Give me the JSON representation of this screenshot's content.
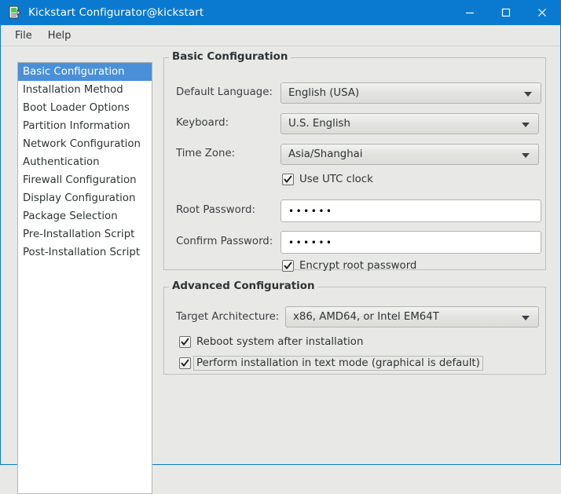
{
  "window": {
    "title": "Kickstart Configurator@kickstart",
    "app_icon": "kickstart-app-icon",
    "accent_color": "#0a7ad0",
    "selection_color": "#4a90d9",
    "controls": {
      "minimize": "minimize-icon",
      "maximize": "maximize-icon",
      "close": "close-icon"
    }
  },
  "menubar": {
    "items": [
      {
        "label": "File"
      },
      {
        "label": "Help"
      }
    ]
  },
  "sidebar": {
    "selected_index": 0,
    "items": [
      {
        "label": "Basic Configuration"
      },
      {
        "label": "Installation Method"
      },
      {
        "label": "Boot Loader Options"
      },
      {
        "label": "Partition Information"
      },
      {
        "label": "Network Configuration"
      },
      {
        "label": "Authentication"
      },
      {
        "label": "Firewall Configuration"
      },
      {
        "label": "Display Configuration"
      },
      {
        "label": "Package Selection"
      },
      {
        "label": "Pre-Installation Script"
      },
      {
        "label": "Post-Installation Script"
      }
    ]
  },
  "basic": {
    "title": "Basic Configuration",
    "language": {
      "label": "Default Language:",
      "value": "English (USA)",
      "arrow": "chevron-down-icon"
    },
    "keyboard": {
      "label": "Keyboard:",
      "value": "U.S. English",
      "arrow": "chevron-down-icon"
    },
    "timezone": {
      "label": "Time Zone:",
      "value": "Asia/Shanghai",
      "arrow": "chevron-down-icon"
    },
    "utc": {
      "label": "Use UTC clock",
      "checked": true
    },
    "root_password": {
      "label": "Root Password:",
      "value": "••••••",
      "placeholder": ""
    },
    "confirm_password": {
      "label": "Confirm Password:",
      "value": "••••••",
      "placeholder": ""
    },
    "encrypt": {
      "label": "Encrypt root password",
      "checked": true
    }
  },
  "advanced": {
    "title": "Advanced Configuration",
    "architecture": {
      "label": "Target Architecture:",
      "value": "x86, AMD64, or Intel EM64T",
      "arrow": "chevron-down-icon"
    },
    "reboot": {
      "label": "Reboot system after installation",
      "checked": true
    },
    "textmode": {
      "label": "Perform installation in text mode (graphical is default)",
      "checked": true,
      "focused": true
    }
  }
}
